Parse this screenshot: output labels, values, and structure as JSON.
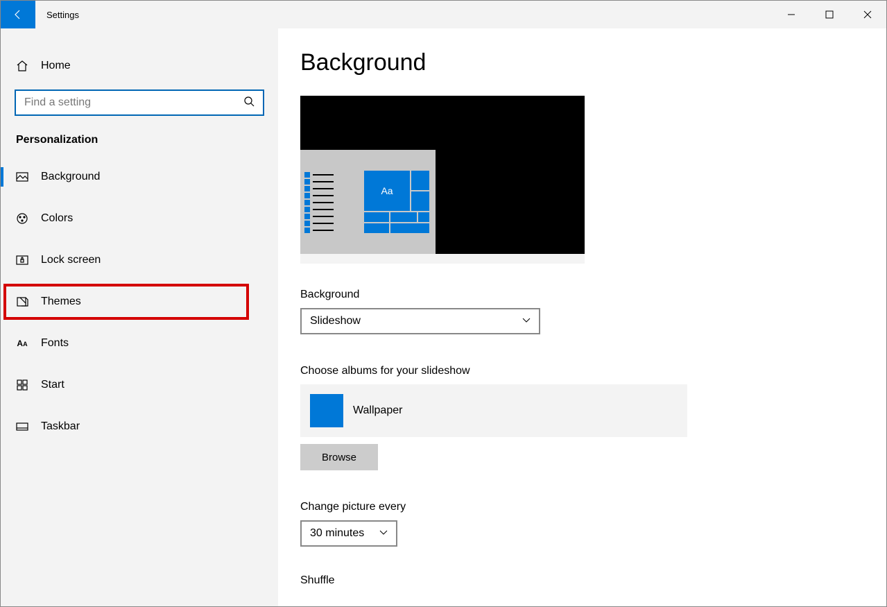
{
  "titlebar": {
    "title": "Settings"
  },
  "sidebar": {
    "home_label": "Home",
    "search_placeholder": "Find a setting",
    "section": "Personalization",
    "items": [
      {
        "label": "Background"
      },
      {
        "label": "Colors"
      },
      {
        "label": "Lock screen"
      },
      {
        "label": "Themes"
      },
      {
        "label": "Fonts"
      },
      {
        "label": "Start"
      },
      {
        "label": "Taskbar"
      }
    ]
  },
  "content": {
    "page_title": "Background",
    "preview_text": "Aa",
    "bg_label": "Background",
    "bg_value": "Slideshow",
    "albums_label": "Choose albums for your slideshow",
    "album_name": "Wallpaper",
    "browse_label": "Browse",
    "interval_label": "Change picture every",
    "interval_value": "30 minutes",
    "shuffle_label": "Shuffle"
  }
}
